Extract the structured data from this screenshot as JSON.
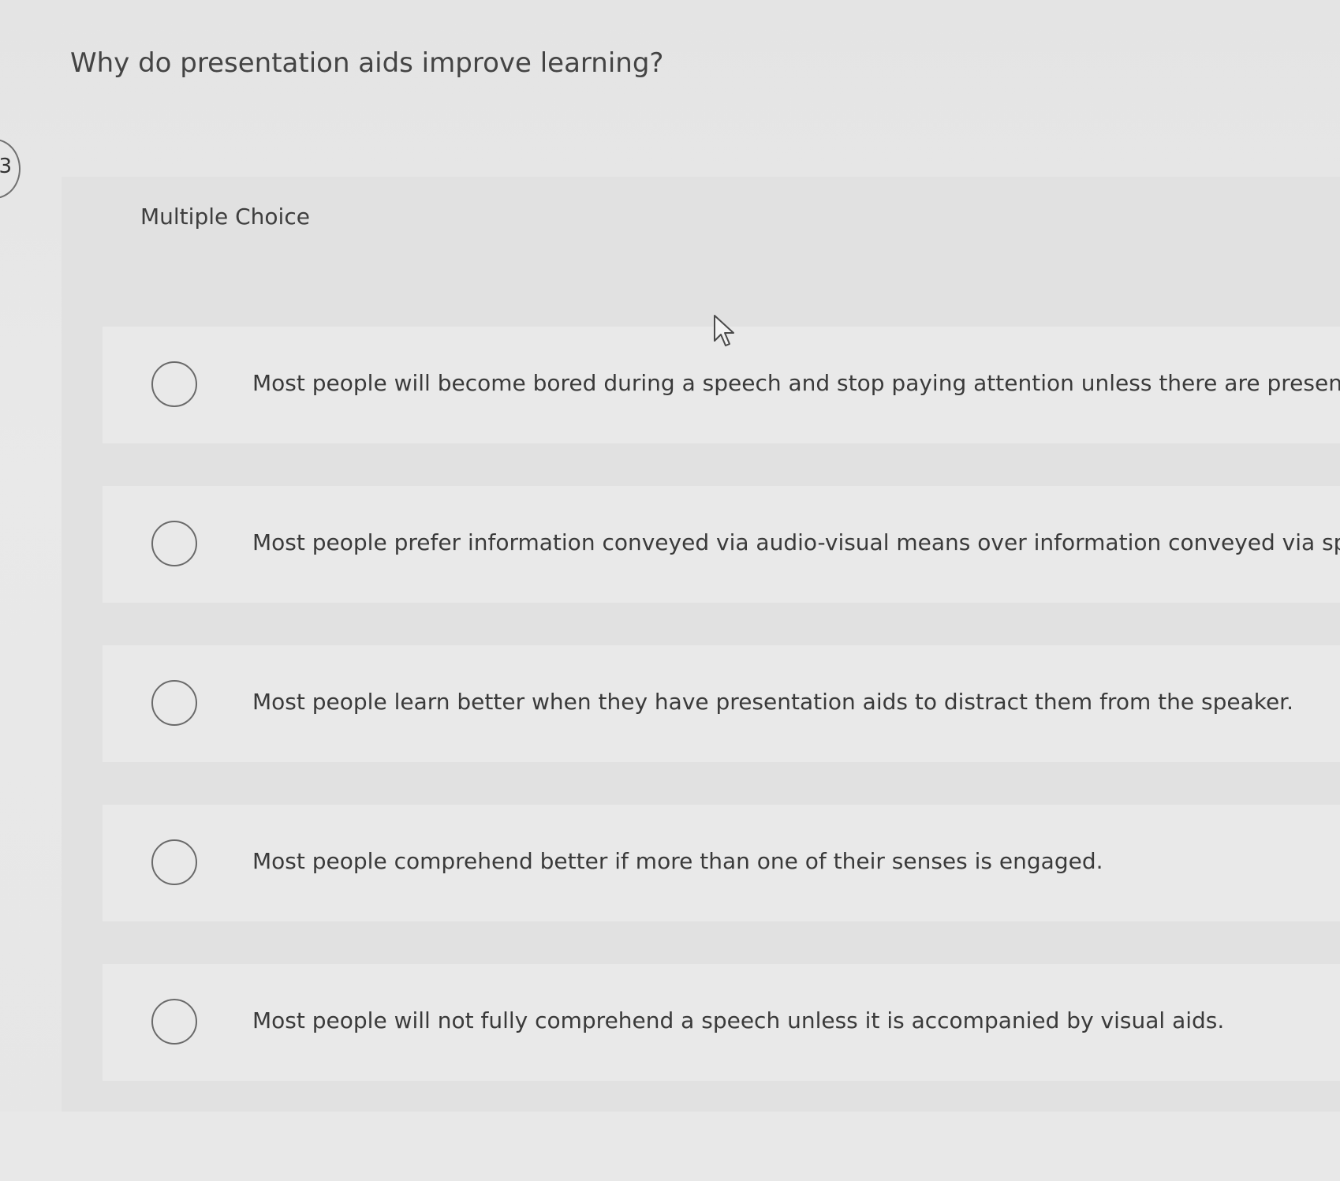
{
  "question": {
    "number": "3",
    "text": "Why do presentation aids improve learning?",
    "type_label": "Multiple Choice"
  },
  "choices": [
    {
      "label": "Most people will become bored during a speech and stop paying attention unless there are presen",
      "selected": false
    },
    {
      "label": "Most people prefer information conveyed via audio-visual means over information conveyed via sp",
      "selected": false
    },
    {
      "label": "Most people learn better when they have presentation aids to distract them from the speaker.",
      "selected": false
    },
    {
      "label": "Most people comprehend better if more than one of their senses is engaged.",
      "selected": false
    },
    {
      "label": "Most people will not fully comprehend a speech unless it is accompanied by visual aids.",
      "selected": false
    }
  ],
  "icons": {
    "radio": "radio-unselected-icon",
    "cursor": "mouse-pointer-icon"
  },
  "colors": {
    "background": "#e4e4e4",
    "panel": "#e1e1e1",
    "choice_row": "#e9e9e9",
    "radio_border": "#6a6a6a",
    "text": "#3a3a3a"
  }
}
